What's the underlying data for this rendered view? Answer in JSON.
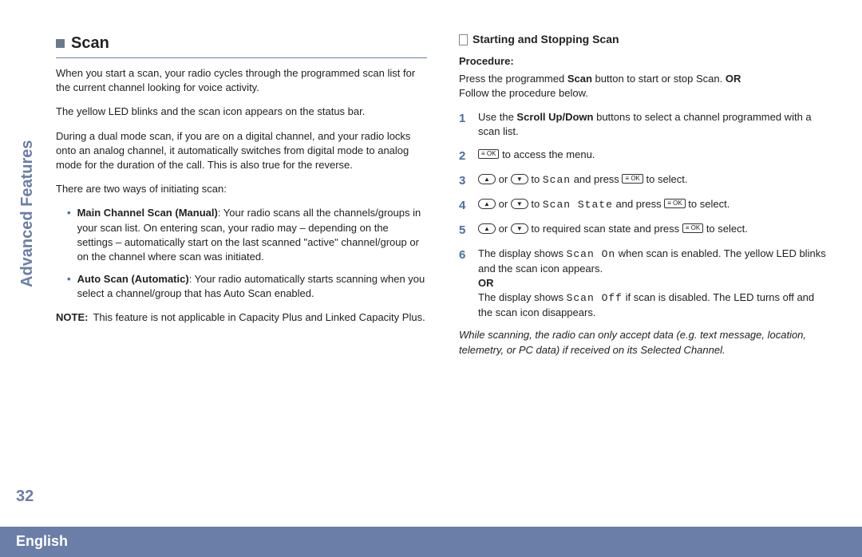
{
  "sidebar": {
    "vertical_label": "Advanced Features",
    "page_number": "32",
    "language": "English"
  },
  "left": {
    "title": "Scan",
    "p1": "When you start a scan, your radio cycles through the programmed scan list for the current channel looking for voice activity.",
    "p2": "The yellow LED blinks and the scan icon appears on the status bar.",
    "p3": "During a dual mode scan, if you are on a digital channel, and your radio locks onto an analog channel, it automatically switches from digital mode to analog mode for the duration of the call. This is also true for the reverse.",
    "p4": "There are two ways of initiating scan:",
    "bullet1_bold": "Main Channel Scan (Manual)",
    "bullet1_rest": ": Your radio scans all the channels/groups in your scan list. On entering scan, your radio may – depending on the settings – automatically start on the last scanned \"active\" channel/group or on the channel where scan was initiated.",
    "bullet2_bold": "Auto Scan (Automatic)",
    "bullet2_rest": ": Your radio automatically starts scanning when you select a channel/group that has Auto Scan enabled.",
    "note_label": "NOTE:",
    "note_text": "This feature is not applicable in Capacity Plus and Linked Capacity Plus."
  },
  "right": {
    "subhead": "Starting and Stopping Scan",
    "procedure_label": "Procedure",
    "intro_a": "Press the programmed ",
    "intro_b_bold": "Scan",
    "intro_c": " button to start or stop Scan. ",
    "intro_d_bold": "OR",
    "intro_e": " Follow the procedure below.",
    "steps": {
      "s1_a": "Use the ",
      "s1_b_bold": "Scroll Up/Down",
      "s1_c": " buttons to select a channel programmed with a scan list.",
      "s2": " to access the menu.",
      "s3_a": " or ",
      "s3_b": " to ",
      "s3_scan": "Scan",
      "s3_c": " and press ",
      "s3_d": " to select.",
      "s4_a": " or ",
      "s4_b": " to ",
      "s4_state": "Scan State",
      "s4_c": " and press ",
      "s4_d": " to select.",
      "s5_a": " or ",
      "s5_b": " to required scan state and press ",
      "s5_c": " to select.",
      "s6_a": "The display shows ",
      "s6_on": "Scan On",
      "s6_b": " when scan is enabled. The yellow LED blinks and the scan icon appears.",
      "s6_or": "OR",
      "s6_c": "The display shows ",
      "s6_off": "Scan Off",
      "s6_d": " if scan is disabled. The LED turns off and the scan icon disappears."
    },
    "footnote": "While scanning, the radio can only accept data (e.g. text message, location, telemetry, or PC data) if received on its Selected Channel.",
    "ok_label": "≡ OK"
  }
}
